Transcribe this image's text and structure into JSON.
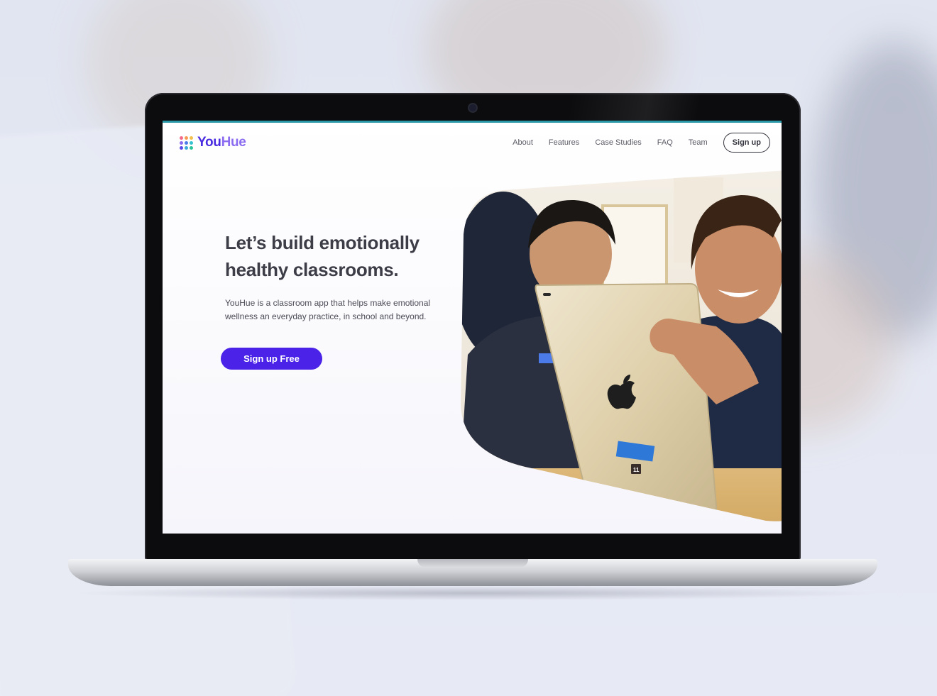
{
  "brand": {
    "name_part1": "You",
    "name_part2": "Hue",
    "dot_colors": [
      "#f46b8a",
      "#f59b56",
      "#f2c14e",
      "#8b6cf0",
      "#4a7be8",
      "#35c2d0",
      "#5a4be8",
      "#3aa8d8",
      "#2bc49a"
    ]
  },
  "nav": {
    "links": [
      "About",
      "Features",
      "Case Studies",
      "FAQ",
      "Team"
    ],
    "signup": "Sign up"
  },
  "hero": {
    "title": "Let’s build emotionally healthy classrooms.",
    "description": "YouHue is a classroom app that helps make emotional wellness an everyday practice, in school and beyond.",
    "cta": "Sign up Free"
  },
  "colors": {
    "accent": "#4a22e8",
    "top_line": "#2b98a8"
  },
  "photo": {
    "badge_text": "11"
  }
}
